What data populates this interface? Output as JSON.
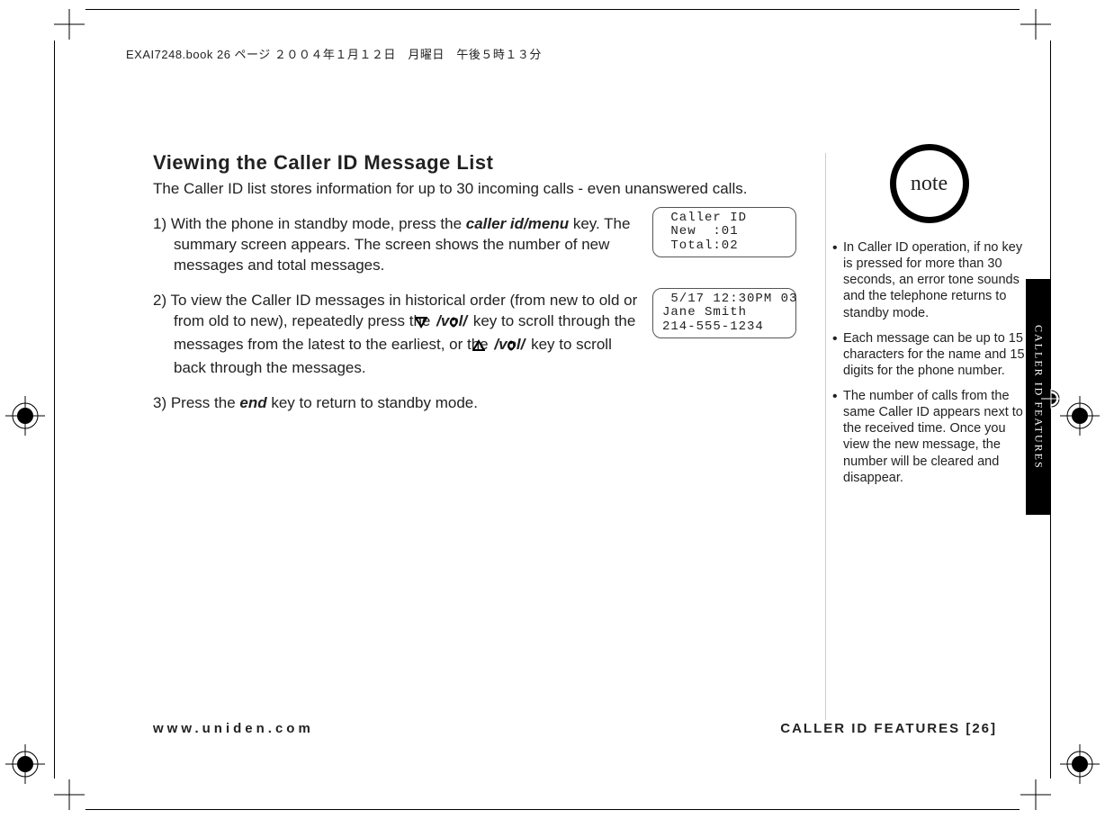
{
  "header_strip": "EXAI7248.book  26 ページ  ２００４年１月１２日　月曜日　午後５時１３分",
  "title": "Viewing the Caller ID Message List",
  "intro": "The Caller ID list stores information for up to 30 incoming calls - even unanswered calls.",
  "step1_a": "1) With the phone in standby mode, press the ",
  "step1_k1": "caller id/menu",
  "step1_b": " key. The summary screen appears. The screen shows the number of new messages and total messages.",
  "step2_a": "2) To view the Caller ID messages in historical order (from new to old or from old to new), repeatedly press the ",
  "step2_vol1": "/vol/",
  "step2_b": " key to scroll through the messages from the latest to the earliest, or the ",
  "step2_vol2": "/vol/",
  "step2_c": " key to scroll back through the messages.",
  "step3_a": "3) Press the ",
  "step3_k": "end",
  "step3_b": " key to return to standby mode.",
  "lcd1": " Caller ID\n New  :01\n Total:02",
  "lcd2": " 5/17 12:30PM 03\nJane Smith\n214-555-1234",
  "note_label": "note",
  "notes": {
    "n1": "In Caller ID operation, if no key is pressed for more than 30 seconds, an error tone sounds and the telephone returns to standby mode.",
    "n2": "Each message can be up to 15 characters for the name and 15 digits for the phone number.",
    "n3": "The number of calls from the same Caller ID appears next to the received time. Once you view the new message, the number will be cleared and disappear."
  },
  "side_tab": "CALLER ID FEATURES",
  "footer_left": "www.uniden.com",
  "footer_right": "CALLER ID FEATURES [26]"
}
